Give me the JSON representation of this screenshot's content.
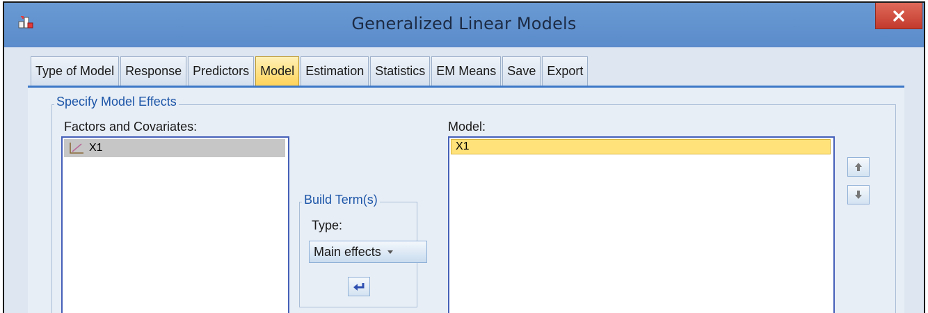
{
  "window": {
    "title": "Generalized Linear Models"
  },
  "tabs": [
    {
      "label": "Type of Model"
    },
    {
      "label": "Response"
    },
    {
      "label": "Predictors"
    },
    {
      "label": "Model",
      "active": true
    },
    {
      "label": "Estimation"
    },
    {
      "label": "Statistics"
    },
    {
      "label": "EM Means"
    },
    {
      "label": "Save"
    },
    {
      "label": "Export"
    }
  ],
  "group": {
    "title": "Specify Model Effects"
  },
  "factors": {
    "label": "Factors and Covariates:",
    "items": [
      "X1"
    ]
  },
  "model": {
    "label": "Model:",
    "items": [
      "X1"
    ]
  },
  "build": {
    "title": "Build Term(s)",
    "type_label": "Type:",
    "type_value": "Main effects"
  },
  "icons": {
    "app": "spss-app-icon",
    "close": "close-icon",
    "variable": "scale-variable-icon",
    "move_up": "arrow-up-icon",
    "move_down": "arrow-down-icon",
    "dropdown": "chevron-down-icon",
    "add_term": "arrow-left-icon"
  },
  "colors": {
    "titlebar": "#5b8ccb",
    "close_button": "#c94a3c",
    "active_tab": "#ffd35a",
    "selected_row": "#ffe27a",
    "tab_line": "#3c77c7",
    "group_title": "#1d56a8",
    "list_border": "#4560b8"
  }
}
